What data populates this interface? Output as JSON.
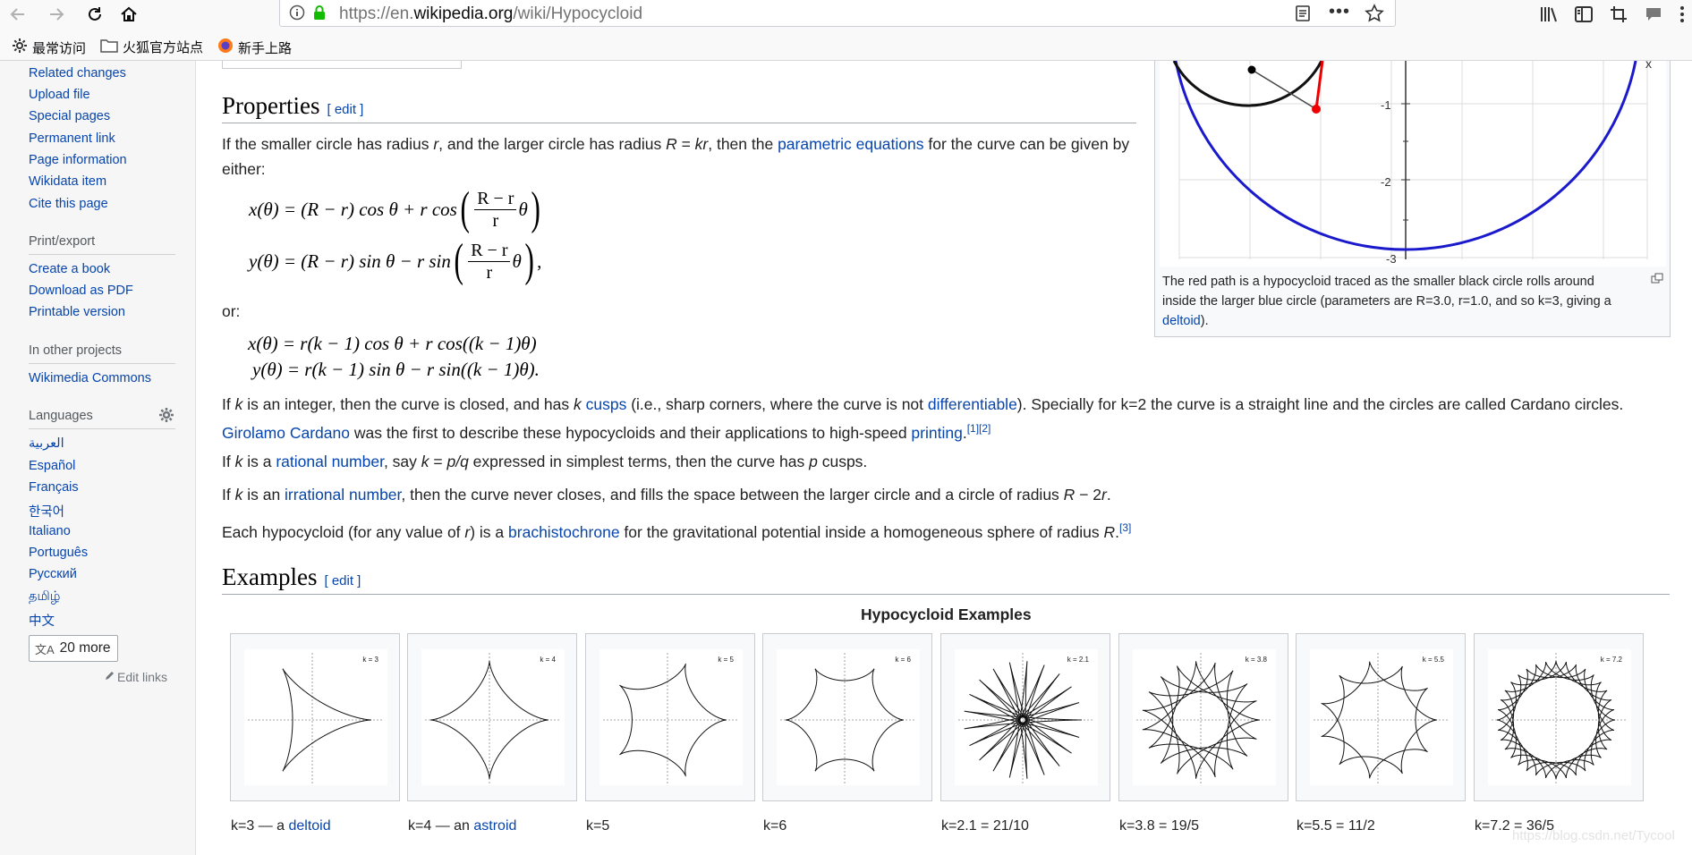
{
  "browser": {
    "url_prefix": "https://en.",
    "url_domain": "wikipedia.org",
    "url_path": "/wiki/Hypocycloid",
    "bookmarks": [
      "最常访问",
      "火狐官方站点",
      "新手上路"
    ]
  },
  "sidebar": {
    "tools_links": [
      "Related changes",
      "Upload file",
      "Special pages",
      "Permanent link",
      "Page information",
      "Wikidata item",
      "Cite this page"
    ],
    "print_heading": "Print/export",
    "print_links": [
      "Create a book",
      "Download as PDF",
      "Printable version"
    ],
    "projects_heading": "In other projects",
    "projects_links": [
      "Wikimedia Commons"
    ],
    "languages_heading": "Languages",
    "languages": [
      "العربية",
      "Español",
      "Français",
      "한국어",
      "Italiano",
      "Português",
      "Русский",
      "தமிழ்",
      "中文"
    ],
    "more_button": "20 more",
    "edit_links": "Edit links"
  },
  "properties": {
    "heading": "Properties",
    "edit": "[ edit ]",
    "intro_1": "If the smaller circle has radius ",
    "intro_r": "r",
    "intro_2": ", and the larger circle has radius ",
    "intro_R": "R",
    "intro_eq": " = ",
    "intro_kr": "kr",
    "intro_3": ", then the ",
    "intro_link": "parametric equations",
    "intro_4": " for the curve can be given by",
    "intro_5": "either:",
    "or": "or:",
    "eq1_lhs": "x(θ) = (R − r) cos θ + r cos",
    "eq2_lhs": "y(θ) = (R − r) sin θ − r sin",
    "frac_num": "R − r",
    "frac_den": "r",
    "theta": "θ",
    "comma": ",",
    "eq3": "x(θ) = r(k − 1) cos θ + r cos((k − 1)θ)",
    "eq4": "y(θ) = r(k − 1) sin θ − r sin((k − 1)θ).",
    "p1_a": "If ",
    "p1_k": "k",
    "p1_b": " is an integer, then the curve is closed, and has ",
    "p1_k2": "k",
    "p1_link1": "cusps",
    "p1_c": " (i.e., sharp corners, where the curve is not ",
    "p1_link2": "differentiable",
    "p1_d": "). Specially for k=2 the curve is a straight line and the circles are called Cardano circles.",
    "p1_link3": "Girolamo Cardano",
    "p1_e": " was the first to describe these hypocycloids and their applications to high-speed ",
    "p1_link4": "printing",
    "p1_ref": "[1][2]",
    "p2_a": "If ",
    "p2_k": "k",
    "p2_b": " is a ",
    "p2_link": "rational number",
    "p2_c": ", say ",
    "p2_k2": "k",
    "p2_d": " = ",
    "p2_pq": "p/q",
    "p2_e": " expressed in simplest terms, then the curve has ",
    "p2_p": "p",
    "p2_f": " cusps.",
    "p3_a": "If ",
    "p3_k": "k",
    "p3_b": " is an ",
    "p3_link": "irrational number",
    "p3_c": ", then the curve never closes, and fills the space between the larger circle and a circle of radius ",
    "p3_R": "R",
    "p3_d": " − 2",
    "p3_r": "r",
    "p3_e": ".",
    "p4_a": "Each hypocycloid (for any value of ",
    "p4_r": "r",
    "p4_b": ") is a ",
    "p4_link": "brachistochrone",
    "p4_c": " for the gravitational potential inside a homogeneous sphere of radius ",
    "p4_R": "R",
    "p4_d": ".",
    "p4_ref": "[3]"
  },
  "figure": {
    "ticks": [
      "-1",
      "-2",
      "-3"
    ],
    "x_label": "x",
    "caption_1": "The red path is a hypocycloid traced as the smaller black circle rolls around",
    "caption_2": "inside the larger blue circle (parameters are R=3.0, r=1.0, and so k=3, giving a",
    "caption_link": "deltoid",
    "caption_end": ")."
  },
  "examples": {
    "heading": "Examples",
    "edit": "[ edit ]",
    "table_title": "Hypocycloid Examples",
    "items": [
      {
        "k_label": "k = 3",
        "k": 3,
        "cap_pre": "k=3 — a ",
        "cap_link": "deltoid"
      },
      {
        "k_label": "k = 4",
        "k": 4,
        "cap_pre": "k=4 — an ",
        "cap_link": "astroid"
      },
      {
        "k_label": "k = 5",
        "k": 5,
        "cap_pre": "k=5",
        "cap_link": ""
      },
      {
        "k_label": "k = 6",
        "k": 6,
        "cap_pre": "k=6",
        "cap_link": ""
      },
      {
        "k_label": "k = 2.1",
        "k": 2.1,
        "cap_pre": "k=2.1 = 21/10",
        "cap_link": ""
      },
      {
        "k_label": "k = 3.8",
        "k": 3.8,
        "cap_pre": "k=3.8 = 19/5",
        "cap_link": ""
      },
      {
        "k_label": "k = 5.5",
        "k": 5.5,
        "cap_pre": "k=5.5 = 11/2",
        "cap_link": ""
      },
      {
        "k_label": "k = 7.2",
        "k": 7.2,
        "cap_pre": "k=7.2 = 36/5",
        "cap_link": ""
      }
    ]
  },
  "watermark": "https://blog.csdn.net/Tycool"
}
